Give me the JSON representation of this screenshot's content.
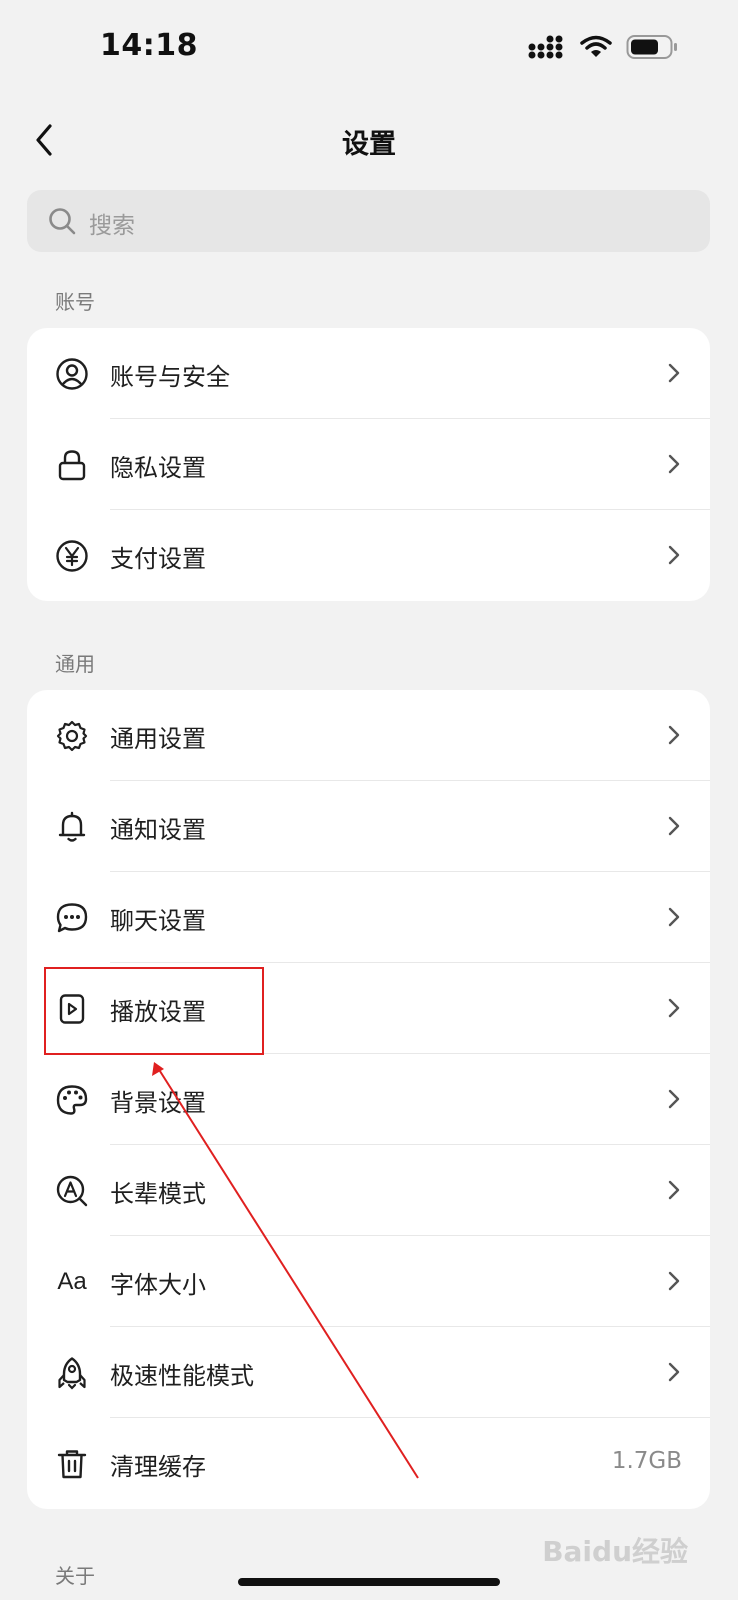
{
  "status_bar": {
    "time": "14:18"
  },
  "nav": {
    "title": "设置"
  },
  "search": {
    "placeholder": "搜索"
  },
  "sections": [
    {
      "title": "账号",
      "items": [
        {
          "label": "账号与安全",
          "icon": "user-icon"
        },
        {
          "label": "隐私设置",
          "icon": "lock-icon"
        },
        {
          "label": "支付设置",
          "icon": "yen-icon"
        }
      ]
    },
    {
      "title": "通用",
      "items": [
        {
          "label": "通用设置",
          "icon": "gear-icon"
        },
        {
          "label": "通知设置",
          "icon": "bell-icon"
        },
        {
          "label": "聊天设置",
          "icon": "chat-icon"
        },
        {
          "label": "播放设置",
          "icon": "play-icon"
        },
        {
          "label": "背景设置",
          "icon": "palette-icon"
        },
        {
          "label": "长辈模式",
          "icon": "elder-mode-icon"
        },
        {
          "label": "字体大小",
          "icon": "font-size-icon",
          "icon_text": "Aa"
        },
        {
          "label": "极速性能模式",
          "icon": "rocket-icon"
        },
        {
          "label": "清理缓存",
          "icon": "trash-icon",
          "value": "1.7GB"
        }
      ]
    },
    {
      "title": "关于"
    }
  ],
  "watermark": "Baidu经验"
}
